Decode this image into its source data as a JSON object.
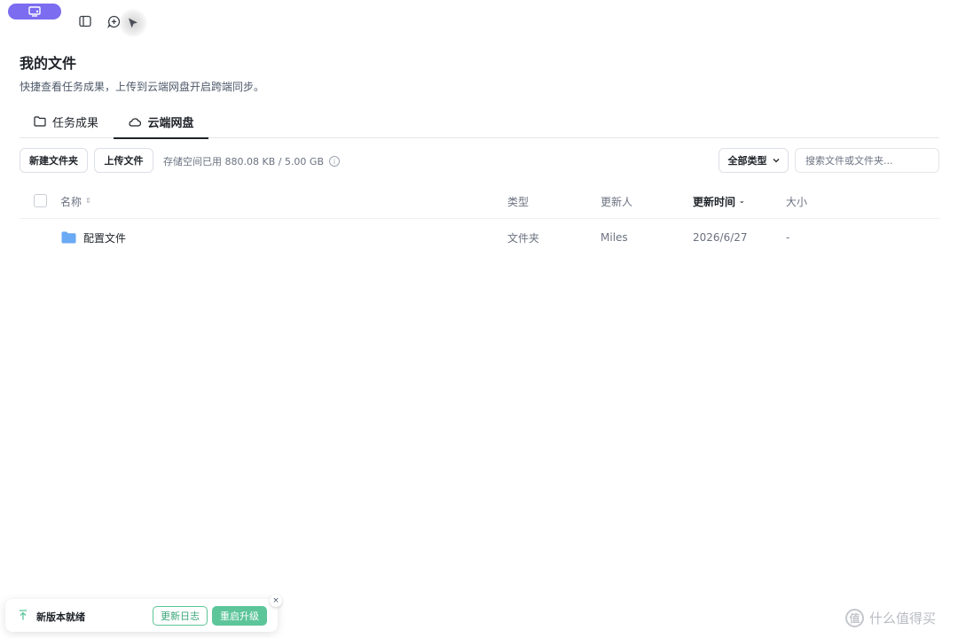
{
  "header": {
    "title": "我的文件",
    "subtitle": "快捷查看任务成果，上传到云端网盘开启跨端同步。"
  },
  "tabs": [
    {
      "label": "任务成果",
      "icon": "folder-icon"
    },
    {
      "label": "云端网盘",
      "icon": "cloud-icon",
      "active": true
    }
  ],
  "toolbar": {
    "new_folder_label": "新建文件夹",
    "upload_label": "上传文件",
    "storage_text": "存储空间已用 880.08 KB / 5.00 GB",
    "type_filter": "全部类型",
    "search_placeholder": "搜索文件或文件夹..."
  },
  "table": {
    "headers": {
      "name": "名称",
      "type": "类型",
      "updated_by": "更新人",
      "updated_at": "更新时间",
      "size": "大小"
    },
    "rows": [
      {
        "name": "配置文件",
        "type": "文件夹",
        "updated_by": "Miles",
        "updated_at": "2026/6/27",
        "size": "-",
        "icon": "folder-icon"
      }
    ]
  },
  "toast": {
    "text": "新版本就绪",
    "log_label": "更新日志",
    "restart_label": "重启升级",
    "close_label": "×"
  },
  "watermark": {
    "circle_text": "值",
    "text": "什么值得买"
  },
  "colors": {
    "accent_purple": "#7b6cf0",
    "folder_blue": "#6aa9f4",
    "success_green": "#5cc59a"
  }
}
